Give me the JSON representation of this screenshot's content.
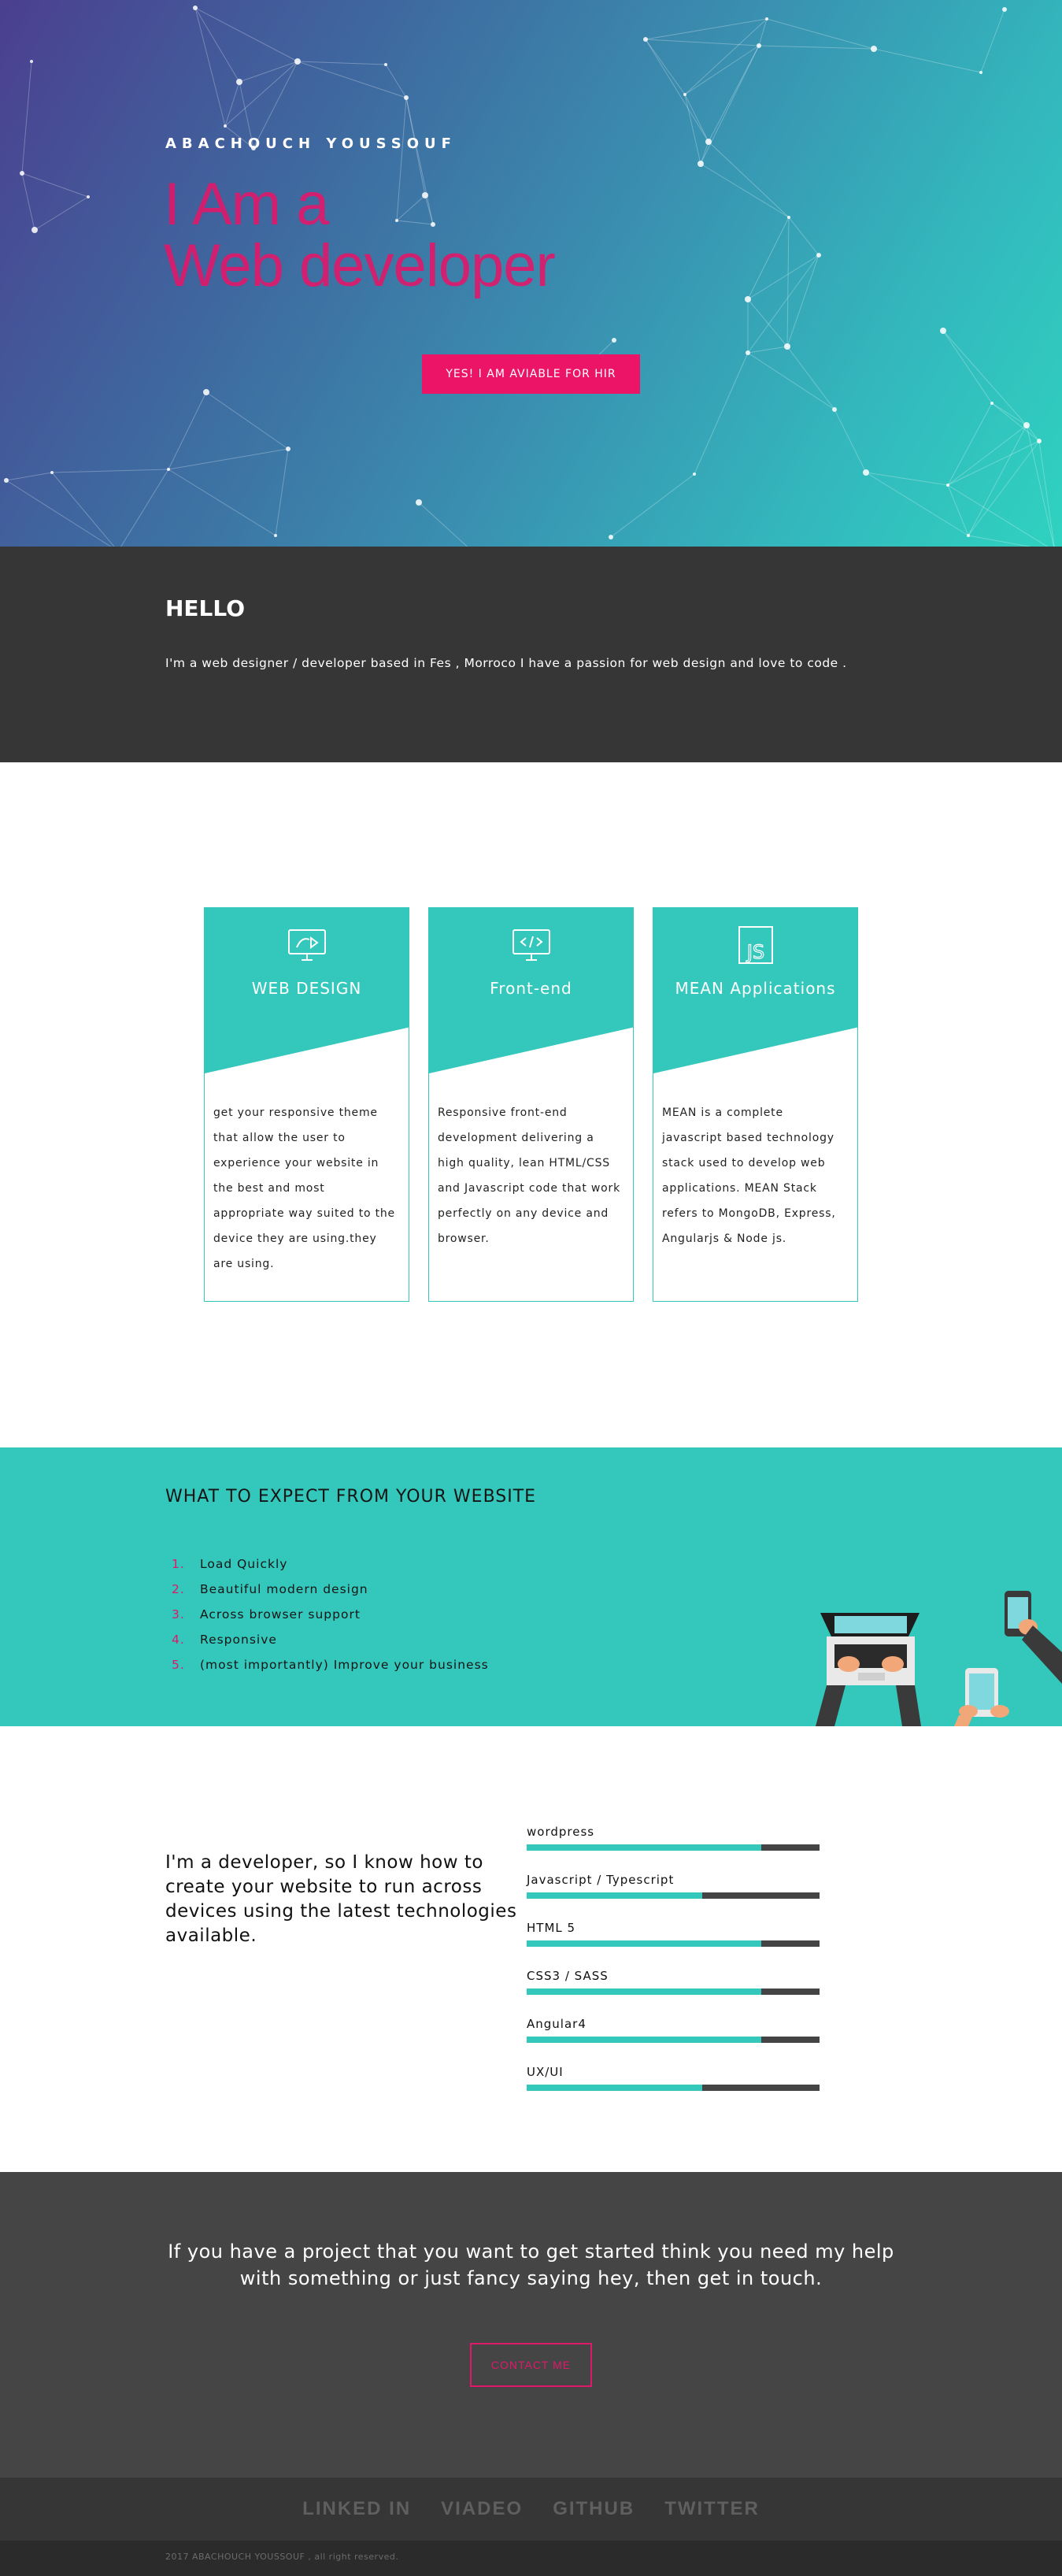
{
  "hero": {
    "name": "ABACHOUCH YOUSSOUF",
    "line1": "I Am a",
    "line2": "Web developer",
    "cta": "YES! I AM AVIABLE FOR HIR"
  },
  "hello": {
    "title": "HELLO",
    "text": "I'm a web designer / developer based in Fes , Morroco I have a passion for web design and love to code ."
  },
  "services": [
    {
      "title": "WEB DESIGN",
      "icon": "monitor-design-icon",
      "text": "get your responsive theme that allow the user to experience your website in the best and most appropriate way suited to the device they are using.they are using."
    },
    {
      "title": "Front-end",
      "icon": "monitor-code-icon",
      "text": "Responsive front-end development delivering a high quality, lean HTML/CSS and Javascript code that work perfectly on any device and browser."
    },
    {
      "title": "MEAN Applications",
      "icon": "js-icon",
      "text": "MEAN is a complete javascript based technology stack used to develop web applications. MEAN Stack refers to MongoDB, Express, Angularjs & Node js."
    }
  ],
  "expect": {
    "title": "WHAT TO EXPECT FROM YOUR WEBSITE",
    "items": [
      {
        "num": "1.",
        "text": "Load Quickly"
      },
      {
        "num": "2.",
        "text": "Beautiful modern design"
      },
      {
        "num": "3.",
        "text": "Across browser support"
      },
      {
        "num": "4.",
        "text": "Responsive"
      },
      {
        "num": "5.",
        "text": "(most importantly) Improve your business"
      }
    ]
  },
  "skills": {
    "intro": "I'm a developer, so I know how to create your website to run across devices using the latest technologies available.",
    "items": [
      {
        "label": "wordpress",
        "level": 0.8
      },
      {
        "label": "Javascript / Typescript",
        "level": 0.6
      },
      {
        "label": "HTML 5",
        "level": 0.8
      },
      {
        "label": "CSS3 / SASS",
        "level": 0.8
      },
      {
        "label": "Angular4",
        "level": 0.8
      },
      {
        "label": "UX/UI",
        "level": 0.6
      }
    ]
  },
  "contact": {
    "text": "If you have a project that you want to get started think you need my help with something or just fancy saying hey, then get in touch.",
    "button": "CONTACT ME"
  },
  "social": [
    "LINKED IN",
    "VIADEO",
    "GITHUB",
    "TWITTER"
  ],
  "copyright": "2017 ABACHOUCH YOUSSOUF , all right reserved.",
  "colors": {
    "accent": "#ec1466",
    "teal": "#33c8bb",
    "dark": "#363636"
  }
}
